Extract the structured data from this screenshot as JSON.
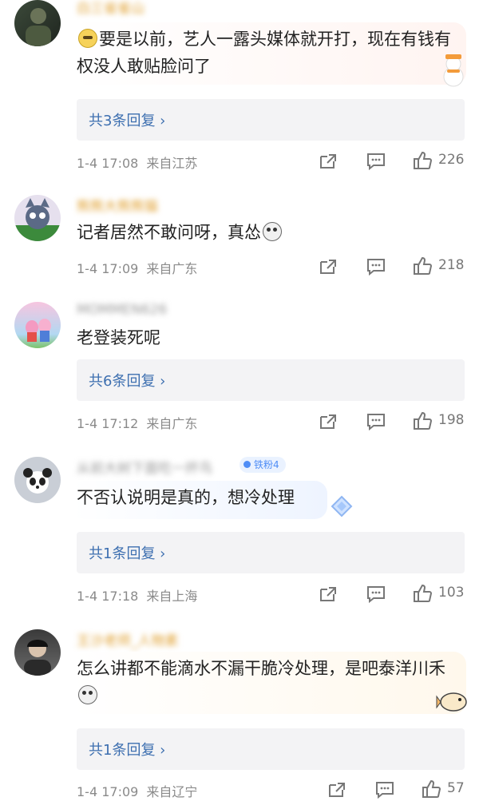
{
  "comments": [
    {
      "username": "白三省雀山",
      "text": "要是以前，艺人一露头媒体就开打，现在有钱有权没人敢贴脸问了",
      "reply_label": "共3条回复 ›",
      "time": "1-4 17:08",
      "location": "来自江苏",
      "likes": "226",
      "avatar_icon": "dark-photo-avatar",
      "leading_emoji": "crying-laugh-emoji"
    },
    {
      "username": "熊熊大熊熊猫",
      "text": "记者居然不敢问呀，真怂",
      "time": "1-4 17:09",
      "location": "来自广东",
      "likes": "218",
      "avatar_icon": "cartoon-cat-avatar",
      "trailing_emoji": "scared-emoji"
    },
    {
      "username": "MOMMEN626",
      "text": "老登装死呢",
      "reply_label": "共6条回复 ›",
      "time": "1-4 17:12",
      "location": "来自广东",
      "likes": "198",
      "avatar_icon": "peppa-pig-avatar"
    },
    {
      "username": "从前大树下面吃一抔鸟",
      "badge": "铁粉4",
      "text": "不否认说明是真的，想冷处理",
      "reply_label": "共1条回复 ›",
      "time": "1-4 17:18",
      "location": "来自上海",
      "likes": "103",
      "avatar_icon": "panda-avatar"
    },
    {
      "username": "王沙老师_人物素",
      "text": "怎么讲都不能滴水不漏干脆冷处理，是吧泰洋川禾",
      "reply_label": "共1条回复 ›",
      "time": "1-4 17:09",
      "location": "来自辽宁",
      "likes": "57",
      "avatar_icon": "person-photo-avatar",
      "trailing_emoji": "scared-emoji"
    }
  ],
  "icons": {
    "share": "share-icon",
    "comment": "comment-icon",
    "like": "thumbs-up-icon"
  }
}
